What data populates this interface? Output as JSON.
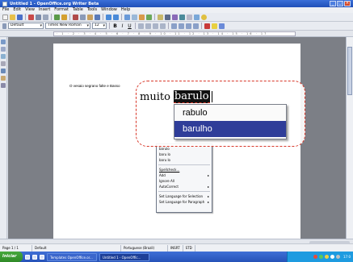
{
  "window": {
    "title": "Untitled 1 - OpenOffice.org Writer Beta",
    "buttons": [
      "_",
      "□",
      "×"
    ]
  },
  "menu": [
    "File",
    "Edit",
    "View",
    "Insert",
    "Format",
    "Table",
    "Tools",
    "Window",
    "Help"
  ],
  "format_toolbar": {
    "style": "Default",
    "font": "Times New Roman",
    "size": "12",
    "bold": "B",
    "italic": "I",
    "underline": "U"
  },
  "ruler": {
    "ticks": "· 1 · 2 · 3 · 4 · 5 · 6 · 7 · 8 · 9 · 10 · 11 · 12 · 13 · 14 · 15 · 16 · 17"
  },
  "document": {
    "text": "O vesaio segrano falte e Basso"
  },
  "context_menu": {
    "suggestions": [
      "barulo",
      "baru lo",
      "baru lo"
    ],
    "items": [
      {
        "label": "Spellcheck...",
        "arrow": false
      },
      {
        "label": "Add",
        "arrow": true
      },
      {
        "label": "Ignore All",
        "arrow": false
      },
      {
        "label": "AutoCorrect",
        "arrow": true
      },
      {
        "label": "Set Language for Selection",
        "arrow": true
      },
      {
        "label": "Set Language for Paragraph",
        "arrow": true
      }
    ]
  },
  "zoom": {
    "word_before": "muito",
    "word_error": "barulo",
    "suggestions": [
      "rabulo",
      "barulho"
    ],
    "selected_index": 1
  },
  "status": {
    "page": "Page 1 / 1",
    "style": "Default",
    "language": "Portuguese (Brazil)",
    "mode": "INSRT",
    "selection": "STD"
  },
  "taskbar": {
    "start": "Iniciar",
    "tasks": [
      "Templates OpenOffice.or...",
      "Untitled 1 - OpenOffic..."
    ],
    "clock": "17:0"
  },
  "colors": {
    "selection": "#2f3d99",
    "callout_border": "#d8382a",
    "titlebar": "#2a5cc4"
  }
}
